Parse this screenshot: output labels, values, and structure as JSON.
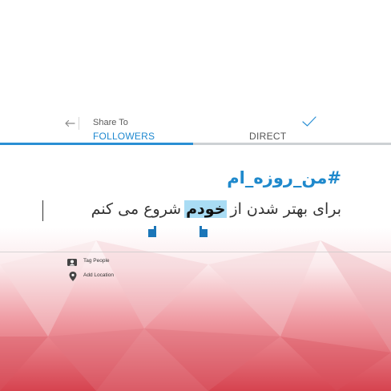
{
  "header": {
    "back_icon": "arrow-left-icon",
    "share_to": "Share To",
    "confirm_icon": "checkmark-icon"
  },
  "tabs": [
    {
      "label": "FOLLOWERS",
      "active": true
    },
    {
      "label": "DIRECT",
      "active": false
    }
  ],
  "caption": {
    "hashtag": "#من_روزه_ام",
    "before_selection": "برای بهتر شدن از",
    "selected_word": "خودم",
    "after_selection": "شروع می کنم"
  },
  "options": [
    {
      "icon": "tag-people-icon",
      "label": "Tag People"
    },
    {
      "icon": "location-pin-icon",
      "label": "Add Location"
    }
  ],
  "colors": {
    "accent": "#2a8fd4",
    "selection": "#a9dcf4",
    "handle": "#1b76b8",
    "background_red": "#d94a55"
  }
}
